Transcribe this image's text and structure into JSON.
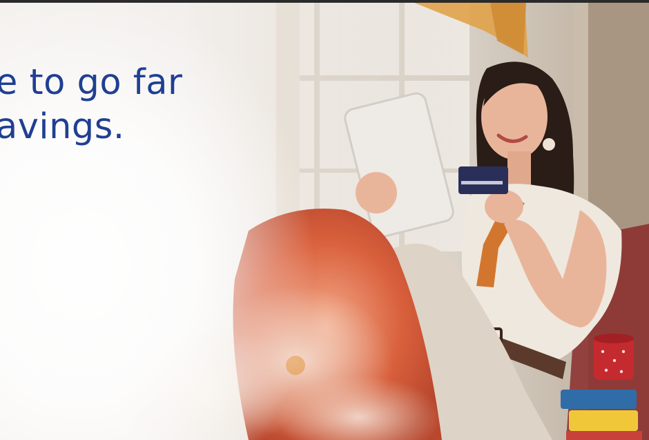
{
  "hero": {
    "headline_line1": "e to go far",
    "headline_line2": "avings."
  },
  "colors": {
    "headline": "#1f3f92",
    "background": "#f2efec"
  }
}
